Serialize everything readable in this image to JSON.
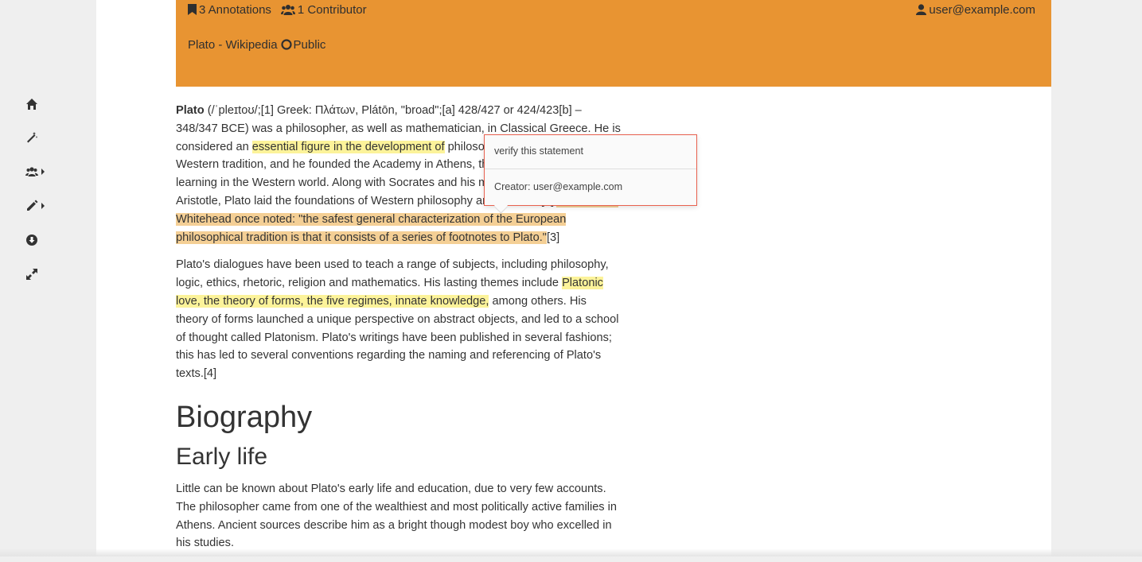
{
  "header": {
    "annotations": "3 Annotations",
    "contributors": "1 Contributor",
    "user": "user@example.com",
    "source": "Plato - Wikipedia",
    "visibility": "Public"
  },
  "toolbar": {
    "items": [
      "home",
      "magic-wand",
      "users",
      "pencil",
      "download",
      "expand"
    ]
  },
  "article": {
    "p1_lead": "Plato",
    "p1_a": " (/ˈpleɪtoʊ/;[1] Greek: Πλάτων, Plátōn, \"broad\";[a] 428/427 or 424/423[b] – 348/347 BCE) was a philosopher, as well as mathematician, in Classical Greece. He is considered an ",
    "p1_hl1": "essential figure in the development of",
    "p1_b": " philosophy, especially the Western tradition, and he founded the Academy in Athens, the first institution of higher learning in the Western world. Along with Socrates and his most famous student, Aristotle, Plato laid the foundations of Western philosophy and science.[2] ",
    "p1_hl2": "Alfred North Whitehead once noted: \"the safest general characterization of the European philosophical tradition is that it consists of a series of footnotes to Plato.\"",
    "p1_c": "[3]",
    "p2_a": "Plato's dialogues have been used to teach a range of subjects, including philosophy, logic, ethics, rhetoric, religion and mathematics. His lasting themes include ",
    "p2_hl": "Platonic love, the theory of forms, the five regimes, innate knowledge,",
    "p2_b": " among others. His theory of forms launched a unique perspective on abstract objects, and led to a school of thought called Platonism. Plato's writings have been published in several fashions; this has led to several conventions regarding the naming and referencing of Plato's texts.[4]",
    "h_biography": "Biography",
    "h_early": "Early life",
    "p3": "Little can be known about Plato's early life and education, due to very few accounts. The philosopher came from one of the wealthiest and most politically active families in Athens. Ancient sources describe him as a bright though modest boy who excelled in his studies."
  },
  "annotation_popup": {
    "text": "verify this statement",
    "creator": "Creator: user@example.com"
  },
  "colors": {
    "header_bg": "#e89432",
    "highlight_yellow": "#fcf39a",
    "highlight_orange": "#f4cf95",
    "popup_border": "#e8614f"
  }
}
